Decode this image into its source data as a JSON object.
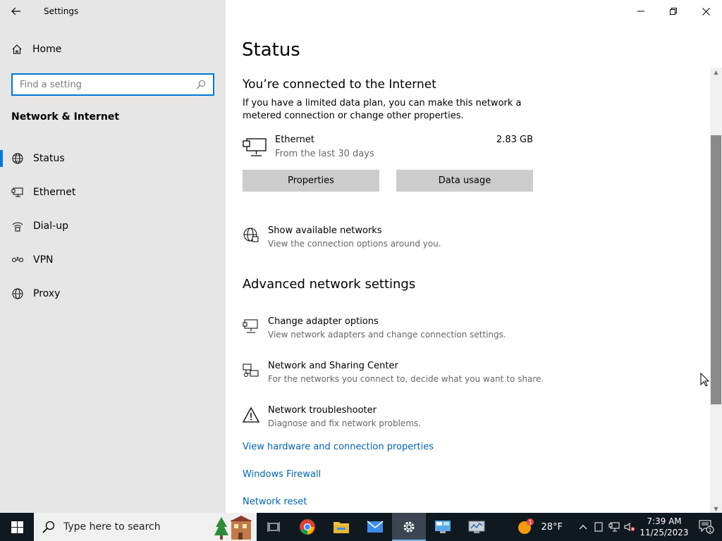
{
  "window": {
    "title": "Settings"
  },
  "sidebar": {
    "home_label": "Home",
    "search_placeholder": "Find a setting",
    "section_title": "Network & Internet",
    "items": [
      {
        "label": "Status"
      },
      {
        "label": "Ethernet"
      },
      {
        "label": "Dial-up"
      },
      {
        "label": "VPN"
      },
      {
        "label": "Proxy"
      }
    ]
  },
  "main": {
    "page_title": "Status",
    "connection_title": "You’re connected to the Internet",
    "connection_desc": "If you have a limited data plan, you can make this network a metered connection or change other properties.",
    "network": {
      "name": "Ethernet",
      "period": "From the last 30 days",
      "usage": "2.83 GB"
    },
    "buttons": {
      "properties": "Properties",
      "data_usage": "Data usage"
    },
    "show_networks": {
      "title": "Show available networks",
      "subtitle": "View the connection options around you."
    },
    "advanced_title": "Advanced network settings",
    "advanced_options": [
      {
        "title": "Change adapter options",
        "subtitle": "View network adapters and change connection settings."
      },
      {
        "title": "Network and Sharing Center",
        "subtitle": "For the networks you connect to, decide what you want to share."
      },
      {
        "title": "Network troubleshooter",
        "subtitle": "Diagnose and fix network problems."
      }
    ],
    "links": [
      "View hardware and connection properties",
      "Windows Firewall",
      "Network reset"
    ]
  },
  "taskbar": {
    "search_text": "Type here to search",
    "weather_temp": "28°F",
    "weather_badge": "1",
    "time": "7:39 AM",
    "date": "11/25/2023",
    "notification_count": "1"
  },
  "colors": {
    "accent": "#0078d7",
    "link": "#0063b1",
    "sidebar_bg": "#e6e6e6",
    "taskbar_bg": "#101820"
  }
}
